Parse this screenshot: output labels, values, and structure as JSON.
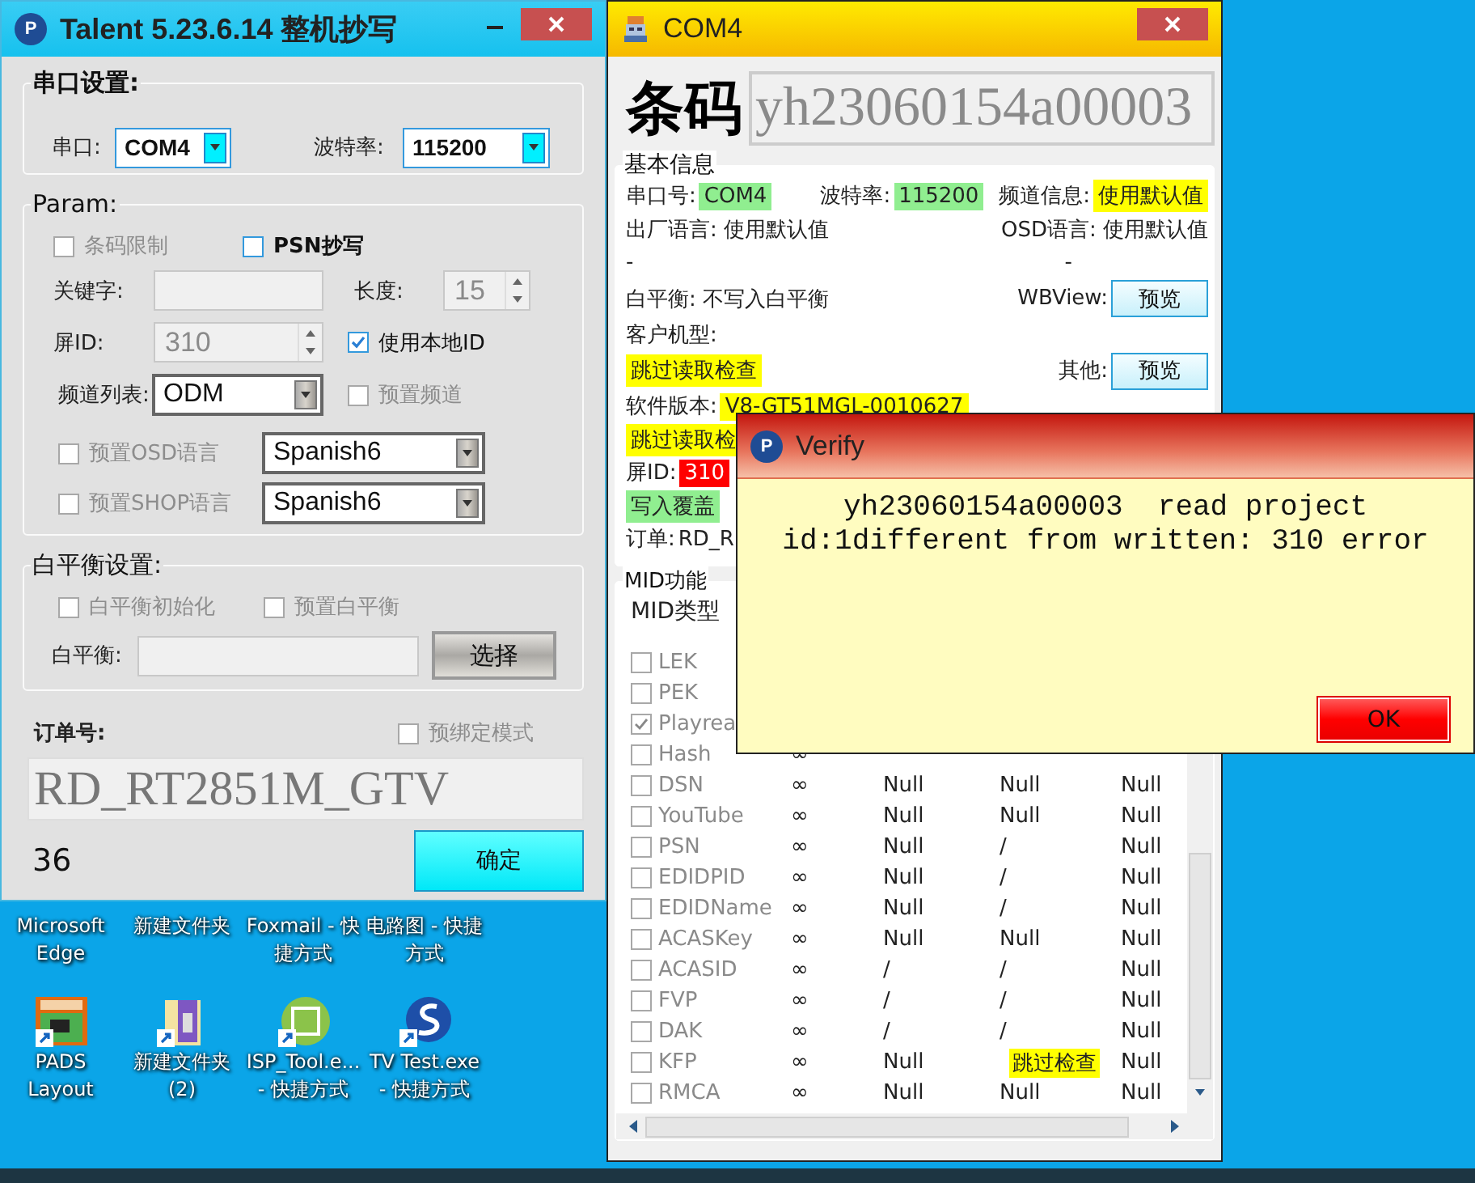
{
  "desktop_icons": [
    {
      "label": "Microsoft Edge",
      "kind": "covered"
    },
    {
      "label": "新建文件夹",
      "kind": "covered"
    },
    {
      "label": "Foxmail - 快捷方式",
      "kind": "covered"
    },
    {
      "label": "电路图 - 快捷方式",
      "kind": "covered"
    },
    {
      "label": "PADS Layout",
      "kind": "board"
    },
    {
      "label": "新建文件夹 (2)",
      "kind": "archive"
    },
    {
      "label": "ISP_Tool.e... - 快捷方式",
      "kind": "chip"
    },
    {
      "label": "TV  Test.exe - 快捷方式",
      "kind": "sphere"
    }
  ],
  "talent": {
    "app_icon": "P",
    "title": "Talent 5.23.6.14  整机抄写",
    "serial_group": {
      "title": "串口设置:",
      "port_label": "串口:",
      "port": "COM4",
      "baud_label": "波特率:",
      "baud": "115200"
    },
    "param_group": {
      "title": "Param:",
      "barcode_limit": {
        "label": "条码限制",
        "checked": false,
        "disabled": true
      },
      "psn_copy": {
        "label": "PSN抄写",
        "checked": false,
        "disabled": false
      },
      "keyword_label": "关键字:",
      "length_label": "长度:",
      "length": "15",
      "screen_id_label": "屏ID:",
      "screen_id": "310",
      "use_local_id": {
        "label": "使用本地ID",
        "checked": true,
        "disabled": false
      },
      "channel_label": "频道列表:",
      "channel": "ODM",
      "preset_channel": {
        "label": "预置频道",
        "checked": false,
        "disabled": true
      },
      "preset_osd": {
        "label": "预置OSD语言",
        "checked": false,
        "disabled": true
      },
      "osd_language": "Spanish6",
      "preset_shop": {
        "label": "预置SHOP语言",
        "checked": false,
        "disabled": true
      },
      "shop_language": "Spanish6"
    },
    "wb_group": {
      "title": "白平衡设置:",
      "wb_init": {
        "label": "白平衡初始化",
        "checked": false,
        "disabled": true
      },
      "preset_wb": {
        "label": "预置白平衡",
        "checked": false,
        "disabled": true
      },
      "wb_label": "白平衡:",
      "select_button": "选择"
    },
    "order_label": "订单号:",
    "prebind": {
      "label": "预绑定模式",
      "checked": false,
      "disabled": true
    },
    "order": "RD_RT2851M_GTV",
    "count": "36",
    "ok_button": "确定"
  },
  "com4": {
    "title": "COM4",
    "barcode_label": "条码",
    "barcode": "yh23060154a00003",
    "info_group": {
      "title": "基本信息",
      "rows": [
        {
          "left": [
            {
              "kind": "text",
              "text": "串口号:"
            },
            {
              "kind": "tag",
              "text": "COM4",
              "color": "#90ee90"
            },
            {
              "kind": "gap"
            },
            {
              "kind": "text",
              "text": "波特率:"
            },
            {
              "kind": "tag",
              "text": "115200",
              "color": "#90ee90"
            }
          ],
          "right": [
            {
              "kind": "text",
              "text": "频道信息:"
            },
            {
              "kind": "tag",
              "text": "使用默认值",
              "color": "#ffff00"
            }
          ]
        },
        {
          "left": [
            {
              "kind": "text",
              "text": "出厂语言: 使用默认值"
            }
          ],
          "right": [
            {
              "kind": "text",
              "text": "OSD语言: 使用默认值"
            }
          ]
        },
        {
          "left": [
            {
              "kind": "text",
              "text": "-"
            }
          ],
          "right": [
            {
              "kind": "text",
              "text": "-"
            },
            {
              "kind": "gap"
            },
            {
              "kind": "gap"
            },
            {
              "kind": "gap"
            }
          ]
        },
        {
          "left": [
            {
              "kind": "text",
              "text": "白平衡: 不写入白平衡"
            }
          ],
          "right": [
            {
              "kind": "text",
              "text": "WBView:"
            },
            {
              "kind": "button",
              "text": "预览"
            }
          ]
        },
        {
          "left": [
            {
              "kind": "text",
              "text": "客户机型:"
            }
          ],
          "right": []
        },
        {
          "left": [
            {
              "kind": "tag",
              "text": "跳过读取检查",
              "color": "#ffff00"
            }
          ],
          "right": [
            {
              "kind": "text",
              "text": "其他:"
            },
            {
              "kind": "button",
              "text": "预览"
            }
          ]
        },
        {
          "left": [
            {
              "kind": "text",
              "text": "软件版本:"
            },
            {
              "kind": "tag",
              "text": "V8-GT51MGL-0010627",
              "color": "#ffff00"
            }
          ],
          "right": []
        },
        {
          "left": [
            {
              "kind": "tag",
              "text": "跳过读取检",
              "color": "#ffff00"
            }
          ],
          "right": []
        },
        {
          "left": [
            {
              "kind": "text",
              "text": "屏ID:"
            },
            {
              "kind": "tag",
              "text": "310",
              "color": "#ff0000"
            }
          ],
          "right": []
        },
        {
          "left": [
            {
              "kind": "tag",
              "text": "写入覆盖",
              "color": "#90ee90"
            }
          ],
          "right": []
        },
        {
          "left": [
            {
              "kind": "text",
              "text": "订单:"
            },
            {
              "kind": "text",
              "text": "RD_R"
            }
          ],
          "right": []
        }
      ]
    },
    "mid_group": {
      "title": "MID功能",
      "header": "MID类型",
      "rows": [
        {
          "name": "LEK",
          "checked": false,
          "cells": []
        },
        {
          "name": "PEK",
          "checked": false,
          "cells": []
        },
        {
          "name": "Playrea",
          "checked": true,
          "cells": []
        },
        {
          "name": "Hash",
          "checked": false,
          "cells": [
            "∞"
          ]
        },
        {
          "name": "DSN",
          "checked": false,
          "cells": [
            "∞",
            "Null",
            "Null",
            "Null"
          ]
        },
        {
          "name": "YouTube",
          "checked": false,
          "cells": [
            "∞",
            "Null",
            "Null",
            "Null"
          ]
        },
        {
          "name": "PSN",
          "checked": false,
          "cells": [
            "∞",
            "Null",
            "/",
            "Null"
          ]
        },
        {
          "name": "EDIDPID",
          "checked": false,
          "cells": [
            "∞",
            "Null",
            "/",
            "Null"
          ]
        },
        {
          "name": "EDIDName",
          "checked": false,
          "cells": [
            "∞",
            "Null",
            "/",
            "Null"
          ]
        },
        {
          "name": "ACASKey",
          "checked": false,
          "cells": [
            "∞",
            "Null",
            "Null",
            "Null"
          ]
        },
        {
          "name": "ACASID",
          "checked": false,
          "cells": [
            "∞",
            "/",
            "/",
            "Null"
          ]
        },
        {
          "name": "FVP",
          "checked": false,
          "cells": [
            "∞",
            "/",
            "/",
            "Null"
          ]
        },
        {
          "name": "DAK",
          "checked": false,
          "cells": [
            "∞",
            "/",
            "/",
            "Null"
          ]
        },
        {
          "name": "KFP",
          "checked": false,
          "cells": [
            "∞",
            "Null",
            {
              "text": "跳过检查",
              "color": "#ffff00"
            },
            "Null"
          ]
        },
        {
          "name": "RMCA",
          "checked": false,
          "cells": [
            "∞",
            "Null",
            "Null",
            "Null"
          ]
        }
      ]
    }
  },
  "verify": {
    "app_icon": "P",
    "title": "Verify",
    "message": "yh23060154a00003  read project id:1different from written: 310 error",
    "ok_button": "OK"
  }
}
